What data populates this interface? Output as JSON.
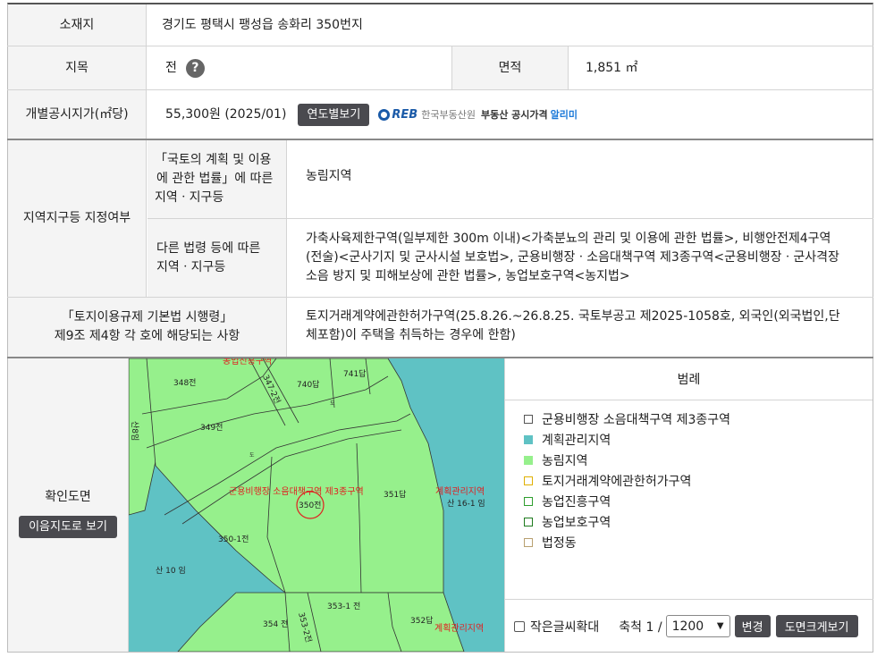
{
  "info": {
    "location_label": "소재지",
    "location_value": "경기도 평택시 팽성읍 송화리 350번지",
    "jimok_label": "지목",
    "jimok_value": "전",
    "help_glyph": "?",
    "area_label": "면적",
    "area_value": "1,851 ㎡",
    "price_label": "개별공시지가(㎡당)",
    "price_value": "55,300원 (2025/01)",
    "yearly_button": "연도별보기",
    "reb_logo": "REB",
    "reb_name": "한국부동산원",
    "reb_service": "부동산 공시가격",
    "reb_service_accent": "알리미"
  },
  "zoning": {
    "section_label": "지역지구등 지정여부",
    "national_law_label_1": "「국토의 계획 및 이용",
    "national_law_label_2": "에 관한 법률」에 따른",
    "national_law_label_3": "지역ㆍ지구등",
    "national_law_value": "농림지역",
    "other_law_label_1": "다른 법령 등에 따른",
    "other_law_label_2": "지역ㆍ지구등",
    "other_law_value_1": "가축사육제한구역(일부제한 300m 이내)<가축분뇨의 관리 및 이용에 관한 법률>, 비행안전제4구역",
    "other_law_value_2": "(전술)<군사기지 및 군사시설 보호법>, 군용비행장ㆍ소음대책구역 제3종구역<군용비행장ㆍ군사격장",
    "other_law_value_3": "소음 방지 및 피해보상에 관한 법률>, 농업보호구역<농지법>"
  },
  "regulation": {
    "label_1": "「토지이용규제 기본법 시행령」",
    "label_2": "제9조 제4항 각 호에 해당되는 사항",
    "value_1": "토지거래계약에관한허가구역(25.8.26.~26.8.25. 국토부공고 제2025-1058호, 외국인(외국법인,단",
    "value_2": "체포함)이 주택을 취득하는 경우에 한함)"
  },
  "map_section": {
    "label": "확인도면",
    "view_button": "이음지도로 보기",
    "labels": {
      "p348": "348전",
      "p347": "347-2전",
      "p740": "740답",
      "p741": "741답",
      "p349": "349전",
      "p350": "350전",
      "p351": "351답",
      "p350_1": "350-1전",
      "p10": "산 10 임",
      "p16_1": "산 16-1 임",
      "p353_1": "353-1 전",
      "p353_2": "353-2전",
      "p354": "354 전",
      "p352": "352답",
      "p_left": "산8임",
      "road1": "도",
      "road2": "도",
      "zone_top": "농업진흥구역",
      "zone_noise": "군용비행장 소음대책구역 제3종구역",
      "zone_plan": "계획관리지역",
      "zone_plan2": "계획관리지역"
    }
  },
  "legend": {
    "title": "범례",
    "items": [
      {
        "label": "군용비행장 소음대책구역 제3종구역",
        "fill": "#ffffff",
        "border": "#555555"
      },
      {
        "label": "계획관리지역",
        "fill": "#5fc2c4",
        "border": "#5fc2c4"
      },
      {
        "label": "농림지역",
        "fill": "#96f08c",
        "border": "#96f08c"
      },
      {
        "label": "토지거래계약에관한허가구역",
        "fill": "#ffffff",
        "border": "#e0b000"
      },
      {
        "label": "농업진흥구역",
        "fill": "#ffffff",
        "border": "#2e9e2e"
      },
      {
        "label": "농업보호구역",
        "fill": "#ffffff",
        "border": "#1e7a1e"
      },
      {
        "label": "법정동",
        "fill": "#ffffff",
        "border": "#b8a070"
      }
    ],
    "small_text_label": "작은글씨확대",
    "scale_label": "축척 1 /",
    "scale_value": "1200",
    "change_button": "변경",
    "enlarge_button": "도면크게보기"
  },
  "colors": {
    "forest_green": "#96f08c",
    "plan_cyan": "#5fc2c4",
    "header_bg": "#f4f4f4",
    "button_dark": "#4a4a4f",
    "zone_red": "#e02020"
  }
}
